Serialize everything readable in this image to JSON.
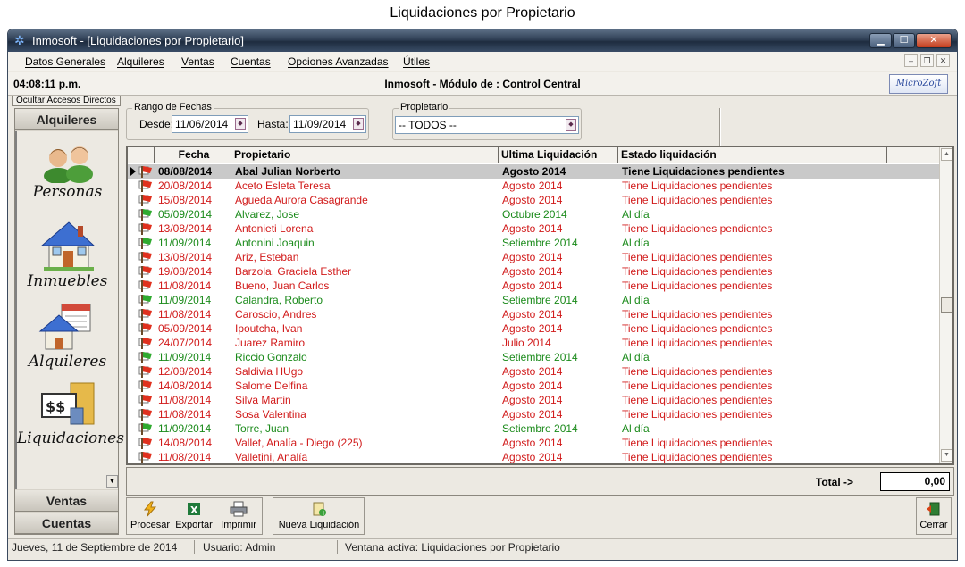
{
  "caption": "Liquidaciones por Propietario",
  "window": {
    "title": "Inmosoft - [Liquidaciones por Propietario]"
  },
  "menu": {
    "items": [
      "Datos Generales",
      "Alquileres",
      "Ventas",
      "Cuentas",
      "Opciones Avanzadas",
      "Útiles"
    ]
  },
  "header": {
    "time": "04:08:11 p.m.",
    "module_title": "Inmosoft - Módulo de : Control Central",
    "logo_text": "MicroZoft"
  },
  "sidebar": {
    "hide_shortcuts": "Ocultar Accesos Directos",
    "active_tab": "Alquileres",
    "items": [
      {
        "label": "Personas",
        "icon": "people-icon"
      },
      {
        "label": "Inmuebles",
        "icon": "house-icon"
      },
      {
        "label": "Alquileres",
        "icon": "rental-icon"
      },
      {
        "label": "Liquidaciones",
        "icon": "money-icon"
      }
    ],
    "bottom_tabs": [
      "Ventas",
      "Cuentas"
    ]
  },
  "filters": {
    "date_range_title": "Rango de Fechas",
    "from_label": "Desde:",
    "from_value": "11/06/2014",
    "to_label": "Hasta:",
    "to_value": "11/09/2014",
    "owner_title": "Propietario",
    "owner_value": "-- TODOS --"
  },
  "table": {
    "columns": [
      "Fecha",
      "Propietario",
      "Ultima Liquidación",
      "Estado liquidación"
    ],
    "rows": [
      {
        "fecha": "08/08/2014",
        "propietario": "Abal Julian Norberto",
        "ultima": "Agosto 2014",
        "estado": "Tiene Liquidaciones pendientes",
        "status": "pending",
        "selected": true
      },
      {
        "fecha": "20/08/2014",
        "propietario": "Aceto Esleta Teresa",
        "ultima": "Agosto 2014",
        "estado": "Tiene Liquidaciones pendientes",
        "status": "pending"
      },
      {
        "fecha": "15/08/2014",
        "propietario": "Agueda Aurora Casagrande",
        "ultima": "Agosto 2014",
        "estado": "Tiene Liquidaciones pendientes",
        "status": "pending"
      },
      {
        "fecha": "05/09/2014",
        "propietario": "Alvarez, Jose",
        "ultima": "Octubre 2014",
        "estado": "Al día",
        "status": "ok"
      },
      {
        "fecha": "13/08/2014",
        "propietario": "Antonieti  Lorena",
        "ultima": "Agosto 2014",
        "estado": "Tiene Liquidaciones pendientes",
        "status": "pending"
      },
      {
        "fecha": "11/09/2014",
        "propietario": "Antonini Joaquin",
        "ultima": "Setiembre 2014",
        "estado": "Al día",
        "status": "ok"
      },
      {
        "fecha": "13/08/2014",
        "propietario": "Ariz, Esteban",
        "ultima": "Agosto 2014",
        "estado": "Tiene Liquidaciones pendientes",
        "status": "pending"
      },
      {
        "fecha": "19/08/2014",
        "propietario": "Barzola, Graciela Esther",
        "ultima": "Agosto 2014",
        "estado": "Tiene Liquidaciones pendientes",
        "status": "pending"
      },
      {
        "fecha": "11/08/2014",
        "propietario": "Bueno, Juan Carlos",
        "ultima": "Agosto 2014",
        "estado": "Tiene Liquidaciones pendientes",
        "status": "pending"
      },
      {
        "fecha": "11/09/2014",
        "propietario": "Calandra, Roberto",
        "ultima": "Setiembre 2014",
        "estado": "Al día",
        "status": "ok"
      },
      {
        "fecha": "11/08/2014",
        "propietario": "Caroscio, Andres",
        "ultima": "Agosto 2014",
        "estado": "Tiene Liquidaciones pendientes",
        "status": "pending"
      },
      {
        "fecha": "05/09/2014",
        "propietario": "Ipoutcha, Ivan",
        "ultima": "Agosto 2014",
        "estado": "Tiene Liquidaciones pendientes",
        "status": "pending"
      },
      {
        "fecha": "24/07/2014",
        "propietario": "Juarez Ramiro",
        "ultima": "Julio 2014",
        "estado": "Tiene Liquidaciones pendientes",
        "status": "pending"
      },
      {
        "fecha": "11/09/2014",
        "propietario": "Riccio Gonzalo",
        "ultima": "Setiembre 2014",
        "estado": "Al día",
        "status": "ok"
      },
      {
        "fecha": "12/08/2014",
        "propietario": "Saldivia HUgo",
        "ultima": "Agosto 2014",
        "estado": "Tiene Liquidaciones pendientes",
        "status": "pending"
      },
      {
        "fecha": "14/08/2014",
        "propietario": "Salome Delfina",
        "ultima": "Agosto 2014",
        "estado": "Tiene Liquidaciones pendientes",
        "status": "pending"
      },
      {
        "fecha": "11/08/2014",
        "propietario": "Silva Martin",
        "ultima": "Agosto 2014",
        "estado": "Tiene Liquidaciones pendientes",
        "status": "pending"
      },
      {
        "fecha": "11/08/2014",
        "propietario": "Sosa Valentina",
        "ultima": "Agosto 2014",
        "estado": "Tiene Liquidaciones pendientes",
        "status": "pending"
      },
      {
        "fecha": "11/09/2014",
        "propietario": "Torre, Juan",
        "ultima": "Setiembre 2014",
        "estado": "Al día",
        "status": "ok"
      },
      {
        "fecha": "14/08/2014",
        "propietario": "Vallet, Analía - Diego (225)",
        "ultima": "Agosto 2014",
        "estado": "Tiene Liquidaciones pendientes",
        "status": "pending"
      },
      {
        "fecha": "11/08/2014",
        "propietario": "Valletini, Analía",
        "ultima": "Agosto 2014",
        "estado": "Tiene Liquidaciones pendientes",
        "status": "pending"
      }
    ]
  },
  "total": {
    "label": "Total ->",
    "value": "0,00"
  },
  "toolbar": {
    "process": "Procesar",
    "export": "Exportar",
    "print": "Imprimir",
    "new_settlement": "Nueva Liquidación",
    "close": "Cerrar"
  },
  "status_bar": {
    "date": "Jueves, 11 de Septiembre de 2014",
    "user": "Usuario: Admin",
    "active_window": "Ventana activa: Liquidaciones por Propietario"
  },
  "colors": {
    "pending": "#d11a1a",
    "ok": "#1a8a1a",
    "selected_row": "#c9c9c9"
  }
}
